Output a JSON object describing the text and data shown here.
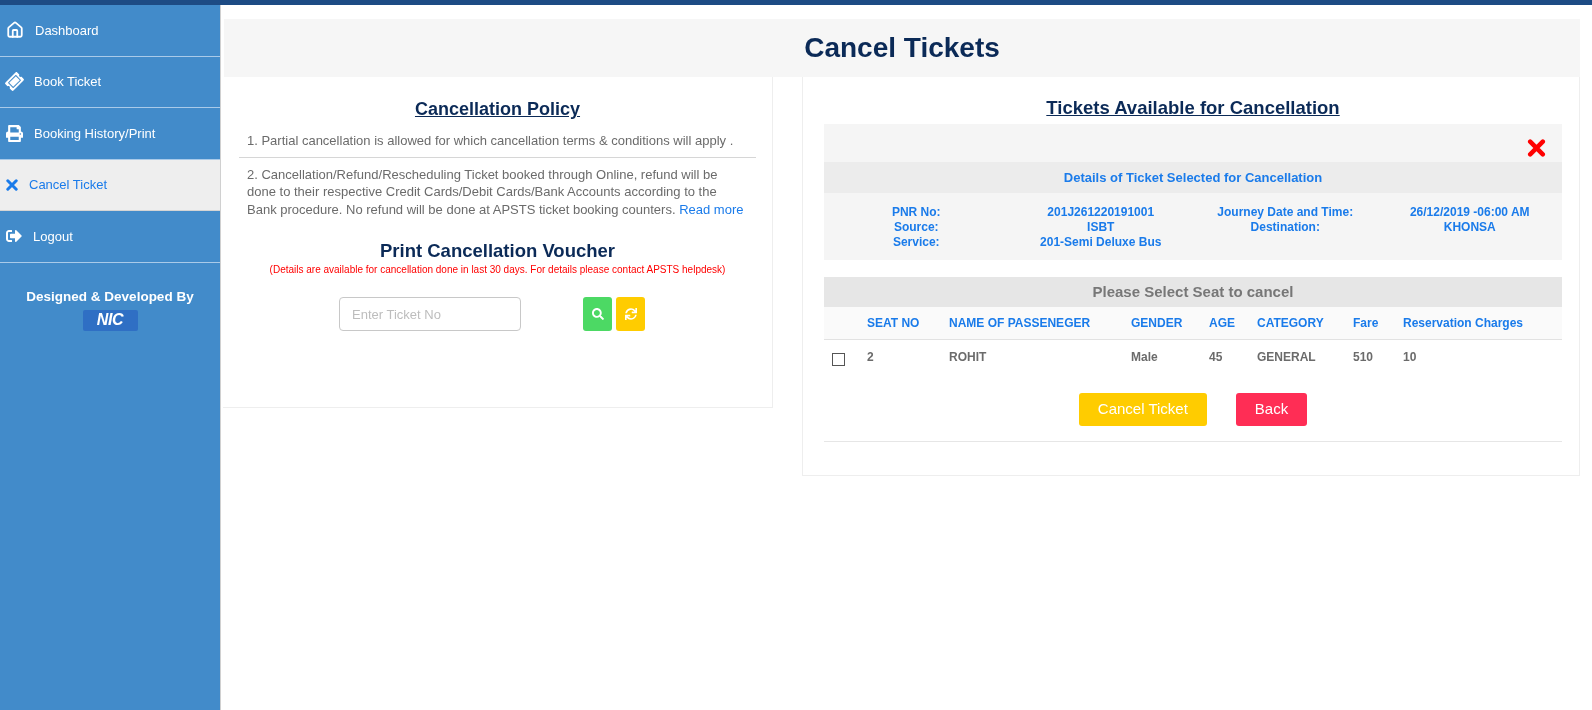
{
  "sidebar": {
    "items": [
      {
        "label": "Dashboard",
        "selected": false
      },
      {
        "label": "Book Ticket",
        "selected": false
      },
      {
        "label": "Booking History/Print",
        "selected": false
      },
      {
        "label": "Cancel Ticket",
        "selected": true
      },
      {
        "label": "Logout",
        "selected": false
      }
    ],
    "credit": "Designed & Developed By",
    "logo": "NIC"
  },
  "header": {
    "title": "Cancel Tickets"
  },
  "policy": {
    "title": "Cancellation Policy",
    "items": [
      {
        "text": "1. Partial cancellation is allowed for which cancellation terms & conditions will apply ."
      },
      {
        "text": "2. Cancellation/Refund/Rescheduling Ticket booked through Online, refund will be done to their respective Credit Cards/Debit Cards/Bank Accounts according to the Bank procedure. No refund will be done at APSTS ticket booking counters.",
        "link": "Read more"
      }
    ]
  },
  "voucher": {
    "title": "Print Cancellation Voucher",
    "note": "(Details are available for cancellation done in last 30 days. For details please contact APSTS helpdesk)",
    "ticket_field": {
      "placeholder": "Enter Ticket No"
    }
  },
  "tickets": {
    "title": "Tickets Available for Cancellation",
    "details": {
      "title": "Details of Ticket Selected for Cancellation",
      "fields": [
        {
          "label": "PNR No:",
          "value": "201J261220191001"
        },
        {
          "label": "Journey Date and Time:",
          "value": "26/12/2019 -06:00 AM"
        },
        {
          "label": "Source:",
          "value": "ISBT"
        },
        {
          "label": "Destination:",
          "value": "KHONSA"
        },
        {
          "label": "Service:",
          "value": "201-Semi Deluxe Bus"
        }
      ]
    },
    "seats": {
      "title": "Please Select Seat to cancel",
      "columns": [
        "SEAT NO",
        "NAME OF PASSENEGER",
        "GENDER",
        "AGE",
        "CATEGORY",
        "Fare",
        "Reservation Charges"
      ],
      "rows": [
        {
          "checked": false,
          "cells": [
            "2",
            "ROHIT",
            "Male",
            "45",
            "GENERAL",
            "510",
            "10"
          ]
        }
      ]
    },
    "buttons": [
      {
        "label": "Cancel Ticket",
        "kind": "warning"
      },
      {
        "label": "Back",
        "kind": "danger"
      }
    ]
  }
}
